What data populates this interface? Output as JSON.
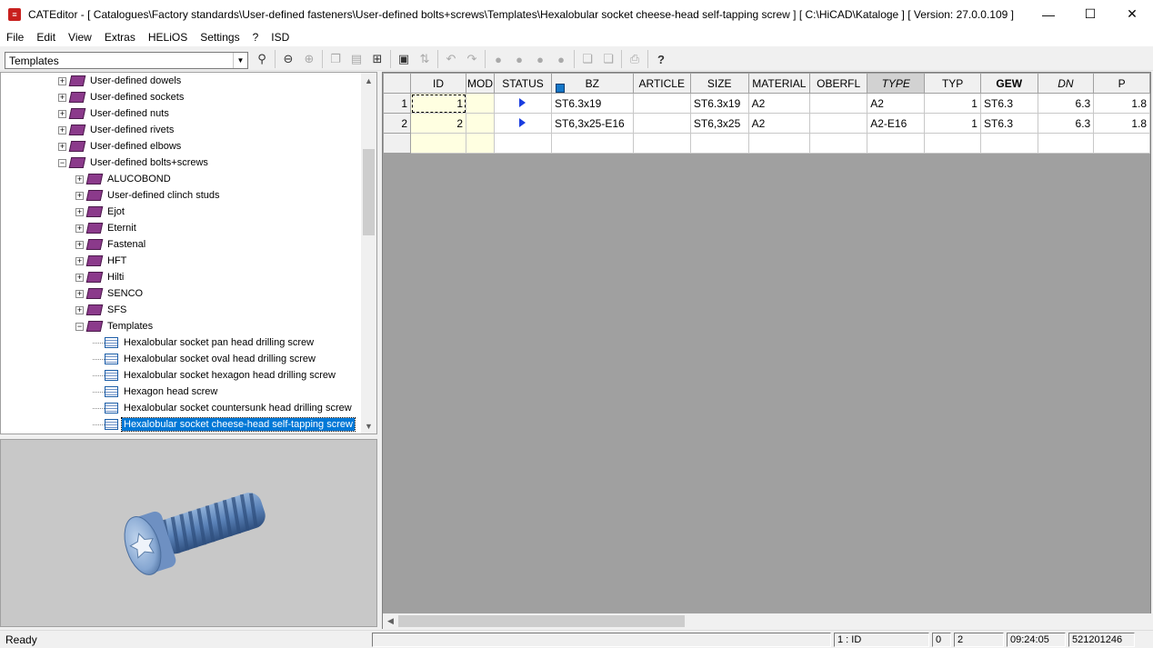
{
  "window": {
    "app_name": "CATEditor",
    "title": "CATEditor - [ Catalogues\\Factory standards\\User-defined fasteners\\User-defined bolts+screws\\Templates\\Hexalobular socket cheese-head self-tapping screw ]        [ C:\\HiCAD\\Kataloge ]  [ Version: 27.0.0.109 ]",
    "minimize": "—",
    "maximize": "☐",
    "close": "✕"
  },
  "menu": [
    "File",
    "Edit",
    "View",
    "Extras",
    "HELiOS",
    "Settings",
    "?",
    "ISD"
  ],
  "toolbar": {
    "combo_value": "Templates"
  },
  "tree": {
    "items": [
      {
        "label": "User-defined dowels",
        "type": "book",
        "expander": "+"
      },
      {
        "label": "User-defined sockets",
        "type": "book",
        "expander": "+"
      },
      {
        "label": "User-defined nuts",
        "type": "book",
        "expander": "+"
      },
      {
        "label": "User-defined rivets",
        "type": "book",
        "expander": "+"
      },
      {
        "label": "User-defined elbows",
        "type": "book",
        "expander": "+"
      },
      {
        "label": "User-defined bolts+screws",
        "type": "book",
        "expander": "−"
      },
      {
        "label": "ALUCOBOND",
        "type": "book",
        "expander": "+"
      },
      {
        "label": "User-defined clinch studs",
        "type": "book",
        "expander": "+"
      },
      {
        "label": "Ejot",
        "type": "book",
        "expander": "+"
      },
      {
        "label": "Eternit",
        "type": "book",
        "expander": "+"
      },
      {
        "label": "Fastenal",
        "type": "book",
        "expander": "+"
      },
      {
        "label": "HFT",
        "type": "book",
        "expander": "+"
      },
      {
        "label": "Hilti",
        "type": "book",
        "expander": "+"
      },
      {
        "label": "SENCO",
        "type": "book",
        "expander": "+"
      },
      {
        "label": "SFS",
        "type": "book",
        "expander": "+"
      },
      {
        "label": "Templates",
        "type": "book",
        "expander": "−"
      },
      {
        "label": "Hexalobular socket pan head drilling screw",
        "type": "table",
        "expander": ""
      },
      {
        "label": "Hexalobular socket oval head drilling screw",
        "type": "table",
        "expander": ""
      },
      {
        "label": "Hexalobular socket hexagon head drilling screw",
        "type": "table",
        "expander": ""
      },
      {
        "label": "Hexagon head screw",
        "type": "table",
        "expander": ""
      },
      {
        "label": "Hexalobular socket countersunk head drilling screw",
        "type": "table",
        "expander": ""
      },
      {
        "label": "Hexalobular socket cheese-head self-tapping screw",
        "type": "table",
        "expander": "",
        "selected": true
      }
    ]
  },
  "grid": {
    "columns": [
      "ID",
      "MOD",
      "STATUS",
      "BZ",
      "ARTICLE",
      "SIZE",
      "MATERIAL",
      "OBERFL",
      "TYPE",
      "TYP",
      "GEW",
      "DN",
      "P"
    ],
    "rows": [
      {
        "num": "1",
        "ID": "1",
        "MOD": "",
        "STATUS": "▶",
        "BZ": "ST6.3x19",
        "ARTICLE": "",
        "SIZE": "ST6.3x19",
        "MATERIAL": "A2",
        "OBERFL": "",
        "TYPE": "A2",
        "TYP": "1",
        "GEW": "ST6.3",
        "DN": "6.3",
        "P": "1.8"
      },
      {
        "num": "2",
        "ID": "2",
        "MOD": "",
        "STATUS": "▶",
        "BZ": "ST6,3x25-E16",
        "ARTICLE": "",
        "SIZE": "ST6,3x25",
        "MATERIAL": "A2",
        "OBERFL": "",
        "TYPE": "A2-E16",
        "TYP": "1",
        "GEW": "ST6.3",
        "DN": "6.3",
        "P": "1.8"
      }
    ]
  },
  "statusbar": {
    "ready": "Ready",
    "field": "1 : ID",
    "count_a": "0",
    "count_b": "2",
    "time": "09:24:05",
    "number": "521201246"
  }
}
